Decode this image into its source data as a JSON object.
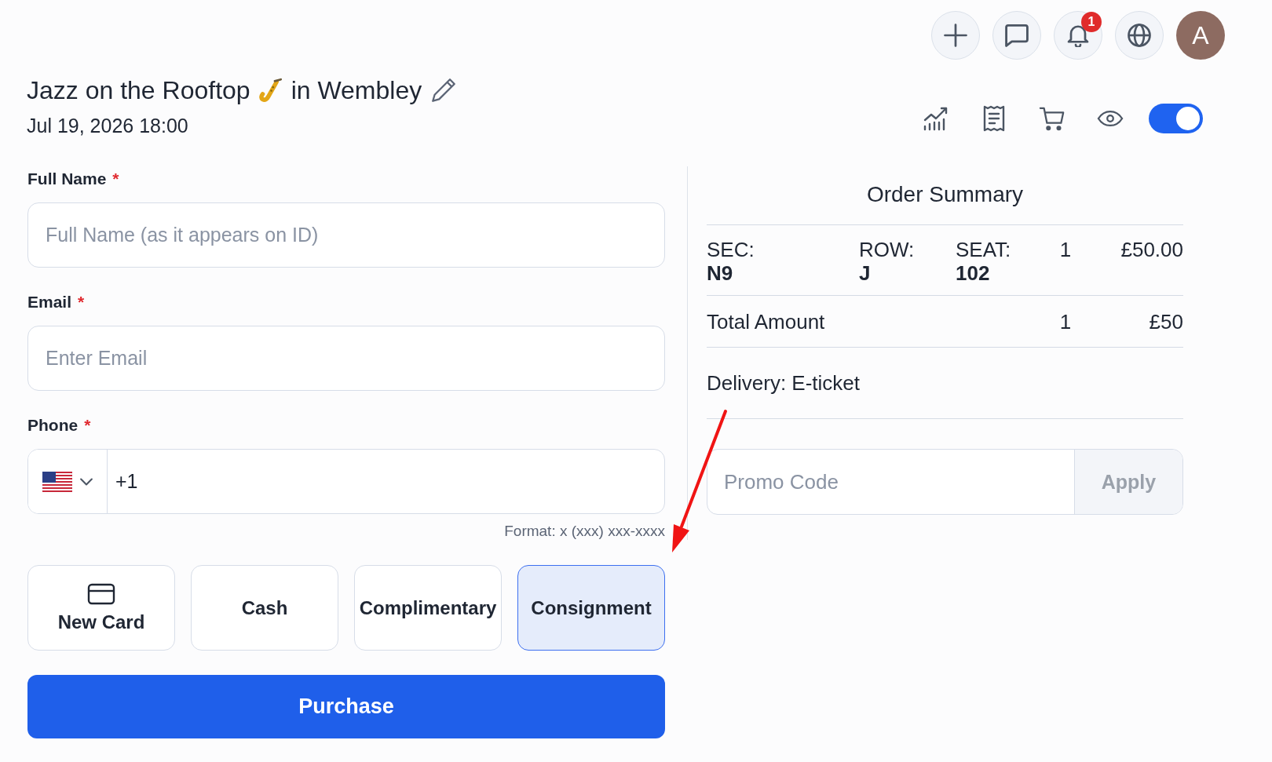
{
  "top_bar": {
    "notification_count": "1",
    "avatar_initial": "A"
  },
  "event": {
    "title": "Jazz on the Rooftop",
    "location": "in Wembley",
    "date": "Jul 19, 2026 18:00"
  },
  "toolbar": {
    "visibility_toggle": {
      "on": true
    }
  },
  "form": {
    "fields": [
      {
        "kind": "text",
        "label": "Full Name",
        "required_mark": "*",
        "placeholder": "Full Name (as it appears on ID)"
      },
      {
        "kind": "text",
        "label": "Email",
        "required_mark": "*",
        "placeholder": "Enter Email"
      },
      {
        "kind": "phone",
        "label": "Phone",
        "required_mark": "*",
        "value": "+1",
        "hint": "Format: x (xxx) xxx-xxxx"
      }
    ],
    "payment_methods": [
      {
        "kind": "card",
        "label": "New Card",
        "selected": false
      },
      {
        "kind": "plain",
        "label": "Cash",
        "selected": false
      },
      {
        "kind": "plain",
        "label": "Complimentary",
        "selected": false
      },
      {
        "kind": "plain",
        "label": "Consignment",
        "selected": true
      }
    ],
    "submit": "Purchase"
  },
  "order_summary": {
    "title": "Order Summary",
    "items": [
      {
        "section_label": "SEC:",
        "section": "N9",
        "row_label": "ROW:",
        "row": "J",
        "seat_label": "SEAT:",
        "seat": "102",
        "quantity": "1",
        "price": "£50.00"
      }
    ],
    "total": {
      "label": "Total Amount",
      "quantity": "1",
      "amount": "£50"
    },
    "delivery": "Delivery: E-ticket",
    "promo": {
      "placeholder": "Promo Code",
      "apply": {
        "label": "Apply",
        "disabled": true
      }
    }
  }
}
